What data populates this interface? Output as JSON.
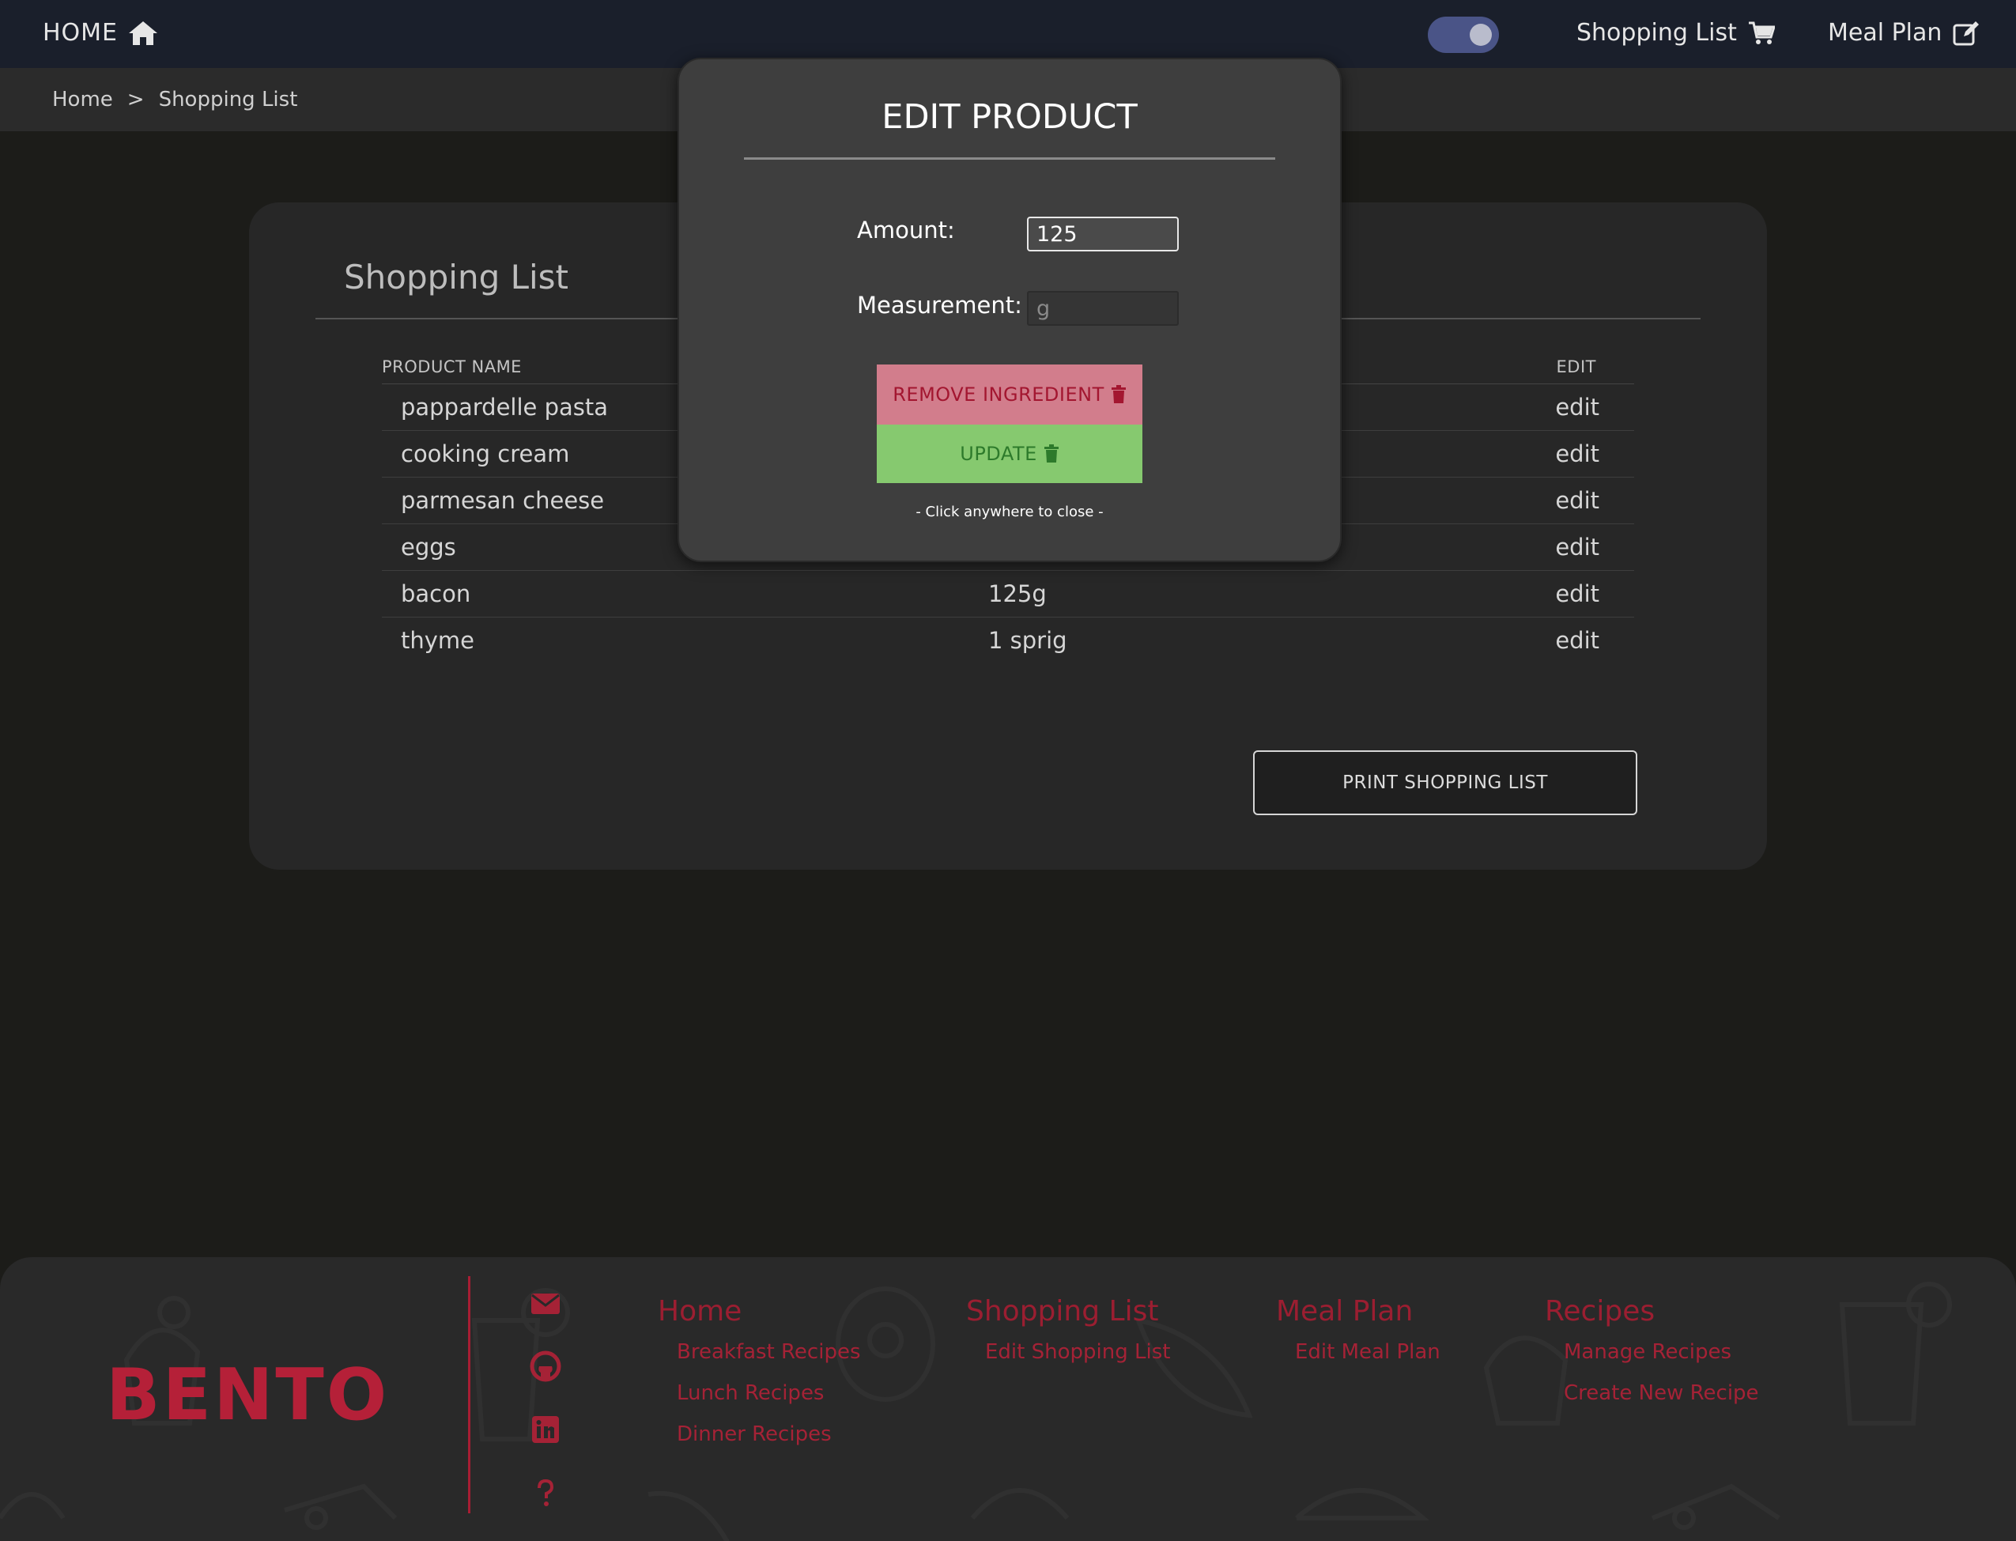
{
  "nav": {
    "home_label": "HOME",
    "shopping_label": "Shopping List",
    "meal_label": "Meal Plan"
  },
  "breadcrumb": {
    "home": "Home",
    "separator": ">",
    "current": "Shopping List"
  },
  "card": {
    "title": "Shopping List",
    "columns": {
      "name": "PRODUCT NAME",
      "edit": "EDIT"
    },
    "rows": [
      {
        "name": "pappardelle pasta",
        "amount": "",
        "edit": "edit"
      },
      {
        "name": "cooking cream",
        "amount": "",
        "edit": "edit"
      },
      {
        "name": "parmesan cheese",
        "amount": "",
        "edit": "edit"
      },
      {
        "name": "eggs",
        "amount": "",
        "edit": "edit"
      },
      {
        "name": "bacon",
        "amount": "125g",
        "edit": "edit"
      },
      {
        "name": "thyme",
        "amount": "1 sprig",
        "edit": "edit"
      }
    ],
    "print_label": "PRINT SHOPPING LIST"
  },
  "modal": {
    "title": "EDIT PRODUCT",
    "amount_label": "Amount:",
    "amount_value": "125",
    "measurement_label": "Measurement:",
    "measurement_placeholder": "g",
    "remove_label": "REMOVE INGREDIENT",
    "update_label": "UPDATE",
    "close_hint": "- Click anywhere to close -"
  },
  "footer": {
    "brand": "BENTO",
    "social_icons": [
      "envelope-icon",
      "github-icon",
      "linkedin-icon",
      "question-icon"
    ],
    "columns": [
      {
        "heading": "Home",
        "links": [
          "Breakfast Recipes",
          "Lunch Recipes",
          "Dinner Recipes"
        ]
      },
      {
        "heading": "Shopping List",
        "links": [
          "Edit Shopping List"
        ]
      },
      {
        "heading": "Meal Plan",
        "links": [
          "Edit Meal Plan"
        ]
      },
      {
        "heading": "Recipes",
        "links": [
          "Manage Recipes",
          "Create New Recipe"
        ]
      }
    ]
  },
  "colors": {
    "nav_bg": "#1a1f2b",
    "accent_red": "#b52038",
    "remove_bg": "#d27d8c",
    "update_bg": "#86c96f",
    "toggle_bg": "#4a5487"
  }
}
